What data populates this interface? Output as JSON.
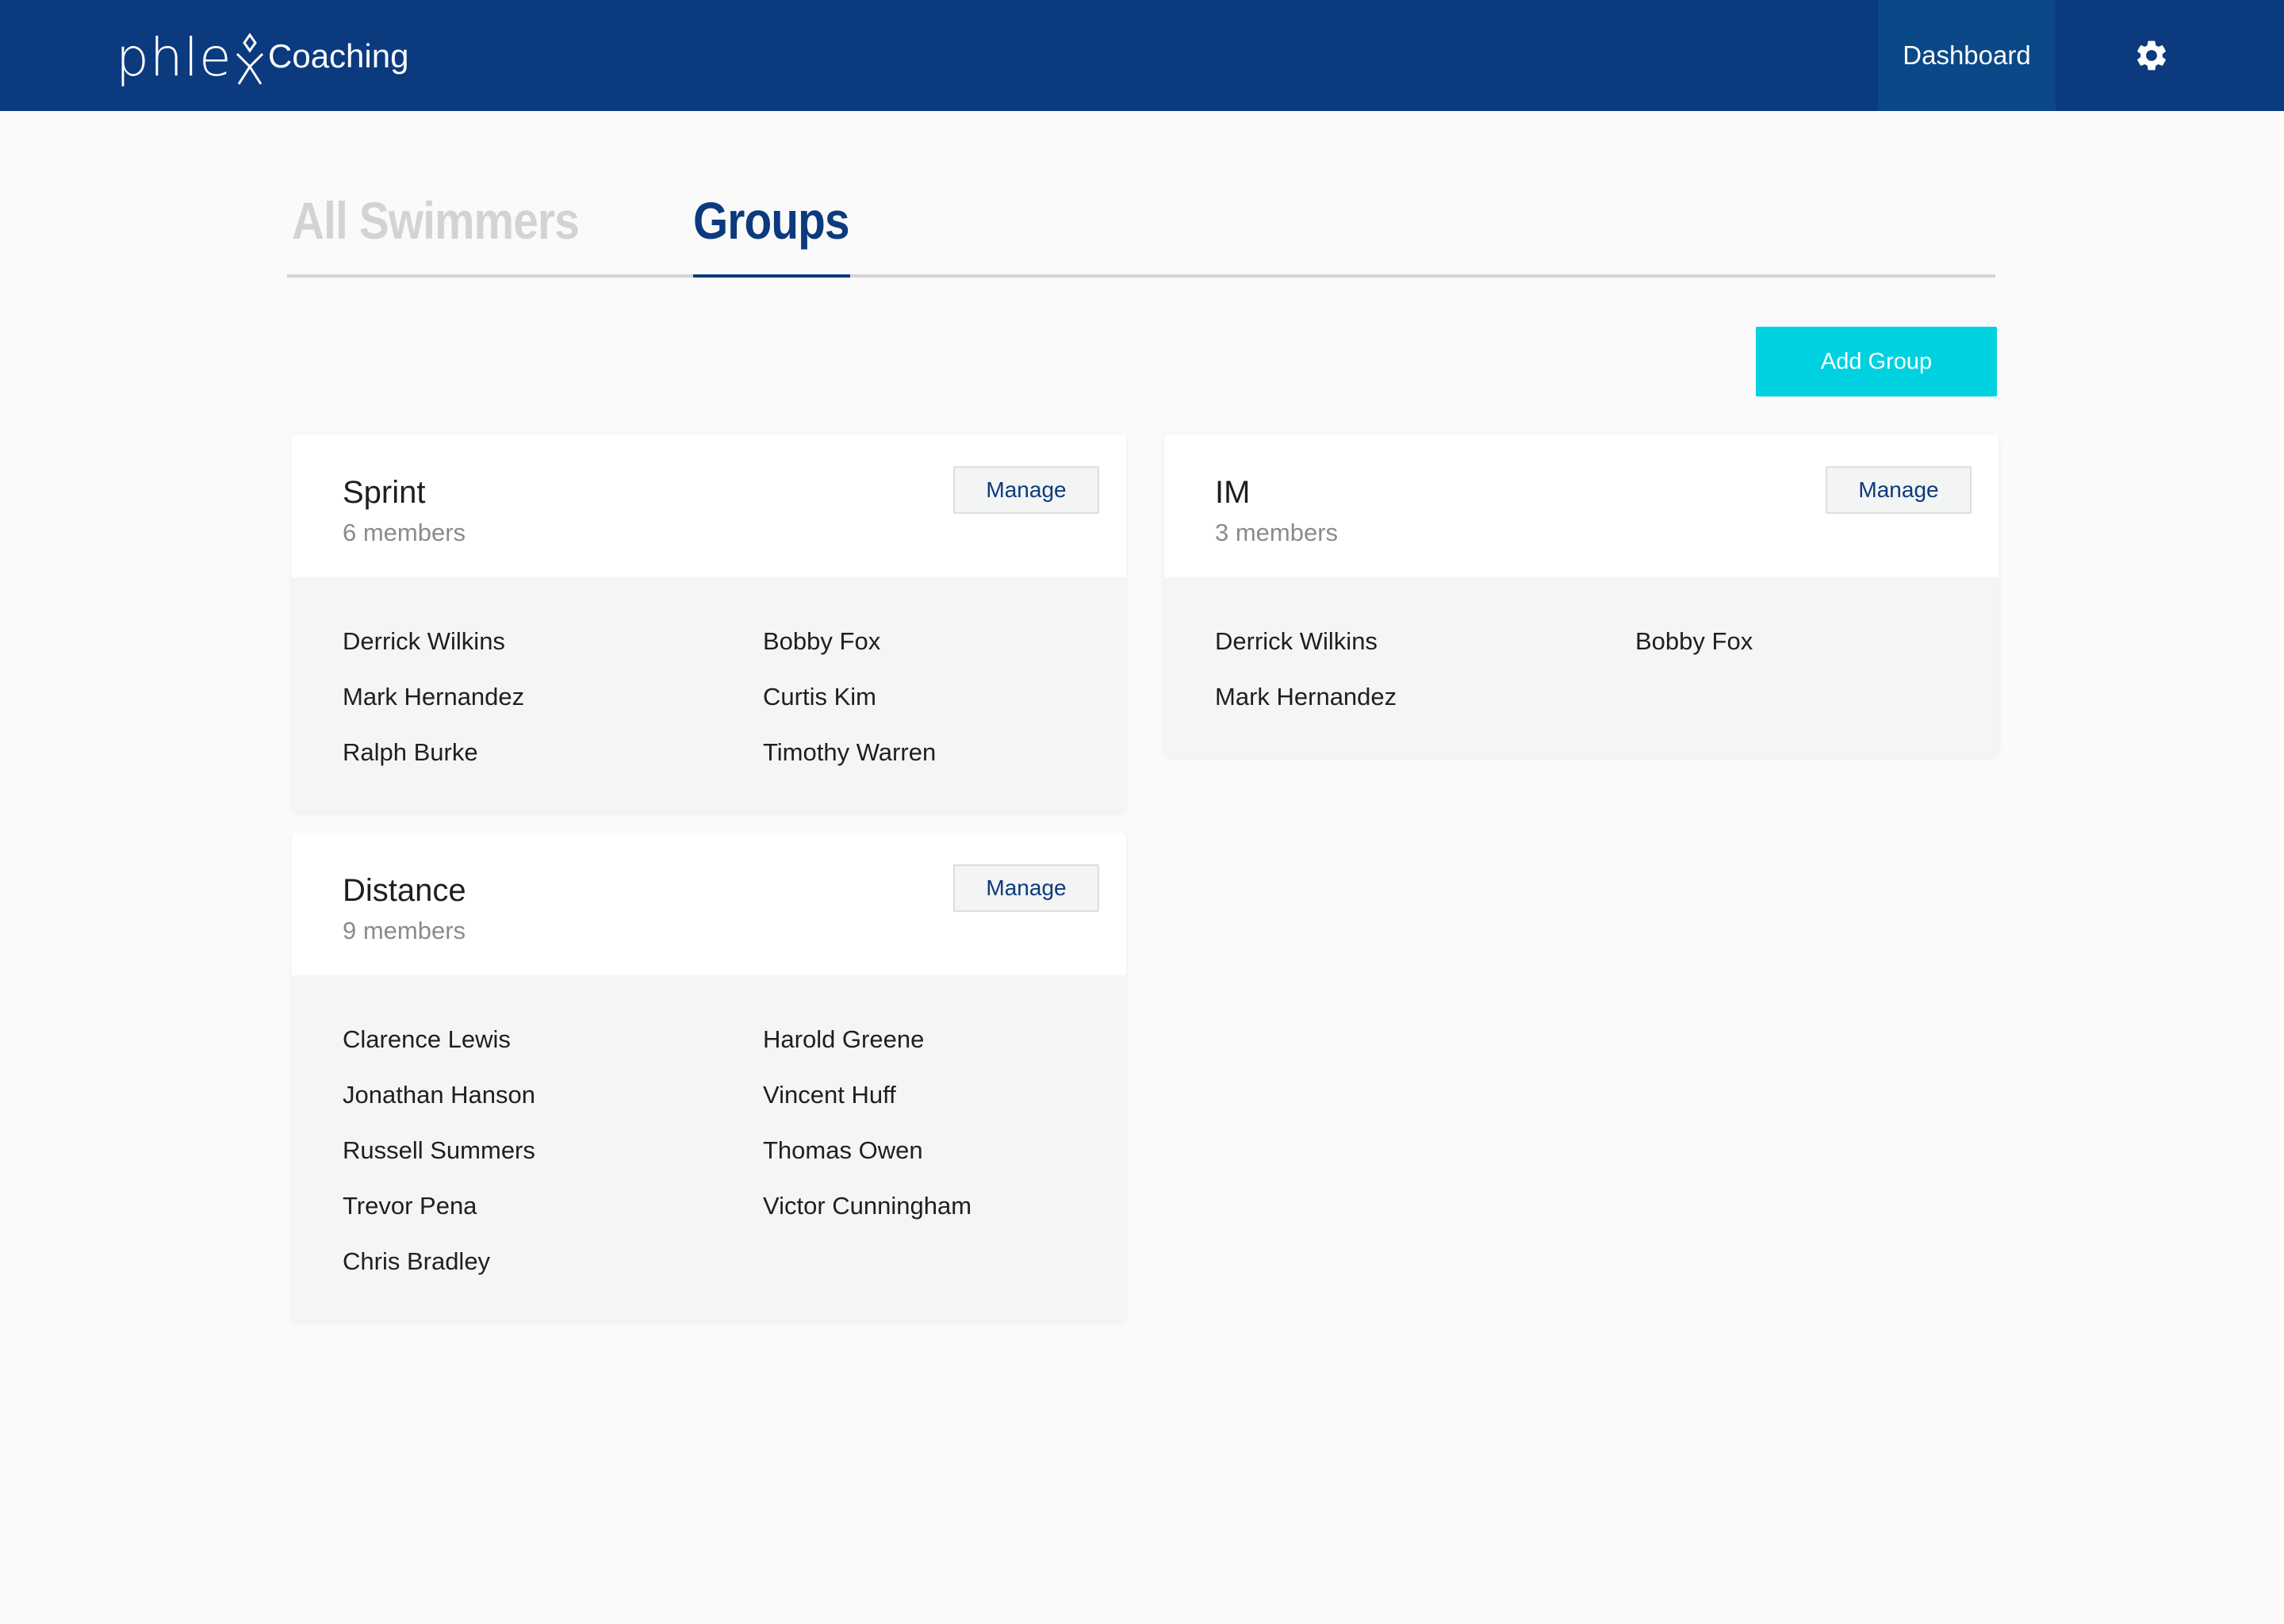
{
  "header": {
    "logo_text": "phle",
    "app_name": "Coaching",
    "nav": {
      "dashboard_label": "Dashboard"
    },
    "settings_icon": "gear-icon",
    "colors": {
      "bar": "#0b3a7e",
      "active_nav": "#0a4888"
    }
  },
  "tabs": [
    {
      "label": "All Swimmers",
      "active": false
    },
    {
      "label": "Groups",
      "active": true
    }
  ],
  "toolbar": {
    "add_group_label": "Add Group",
    "accent": "#00d1e0"
  },
  "groups": [
    {
      "name": "Sprint",
      "count_label": "6 members",
      "manage_label": "Manage",
      "members": [
        "Derrick Wilkins",
        "Bobby Fox",
        "Mark Hernandez",
        "Curtis Kim",
        "Ralph Burke",
        "Timothy Warren"
      ]
    },
    {
      "name": "IM",
      "count_label": "3 members",
      "manage_label": "Manage",
      "members": [
        "Derrick Wilkins",
        "Bobby Fox",
        "Mark Hernandez"
      ]
    },
    {
      "name": "Distance",
      "count_label": "9 members",
      "manage_label": "Manage",
      "members": [
        "Clarence Lewis",
        "Harold Greene",
        "Jonathan Hanson",
        "Vincent Huff",
        "Russell Summers",
        "Thomas Owen",
        "Trevor Pena",
        "Victor Cunningham",
        "Chris Bradley"
      ]
    }
  ]
}
